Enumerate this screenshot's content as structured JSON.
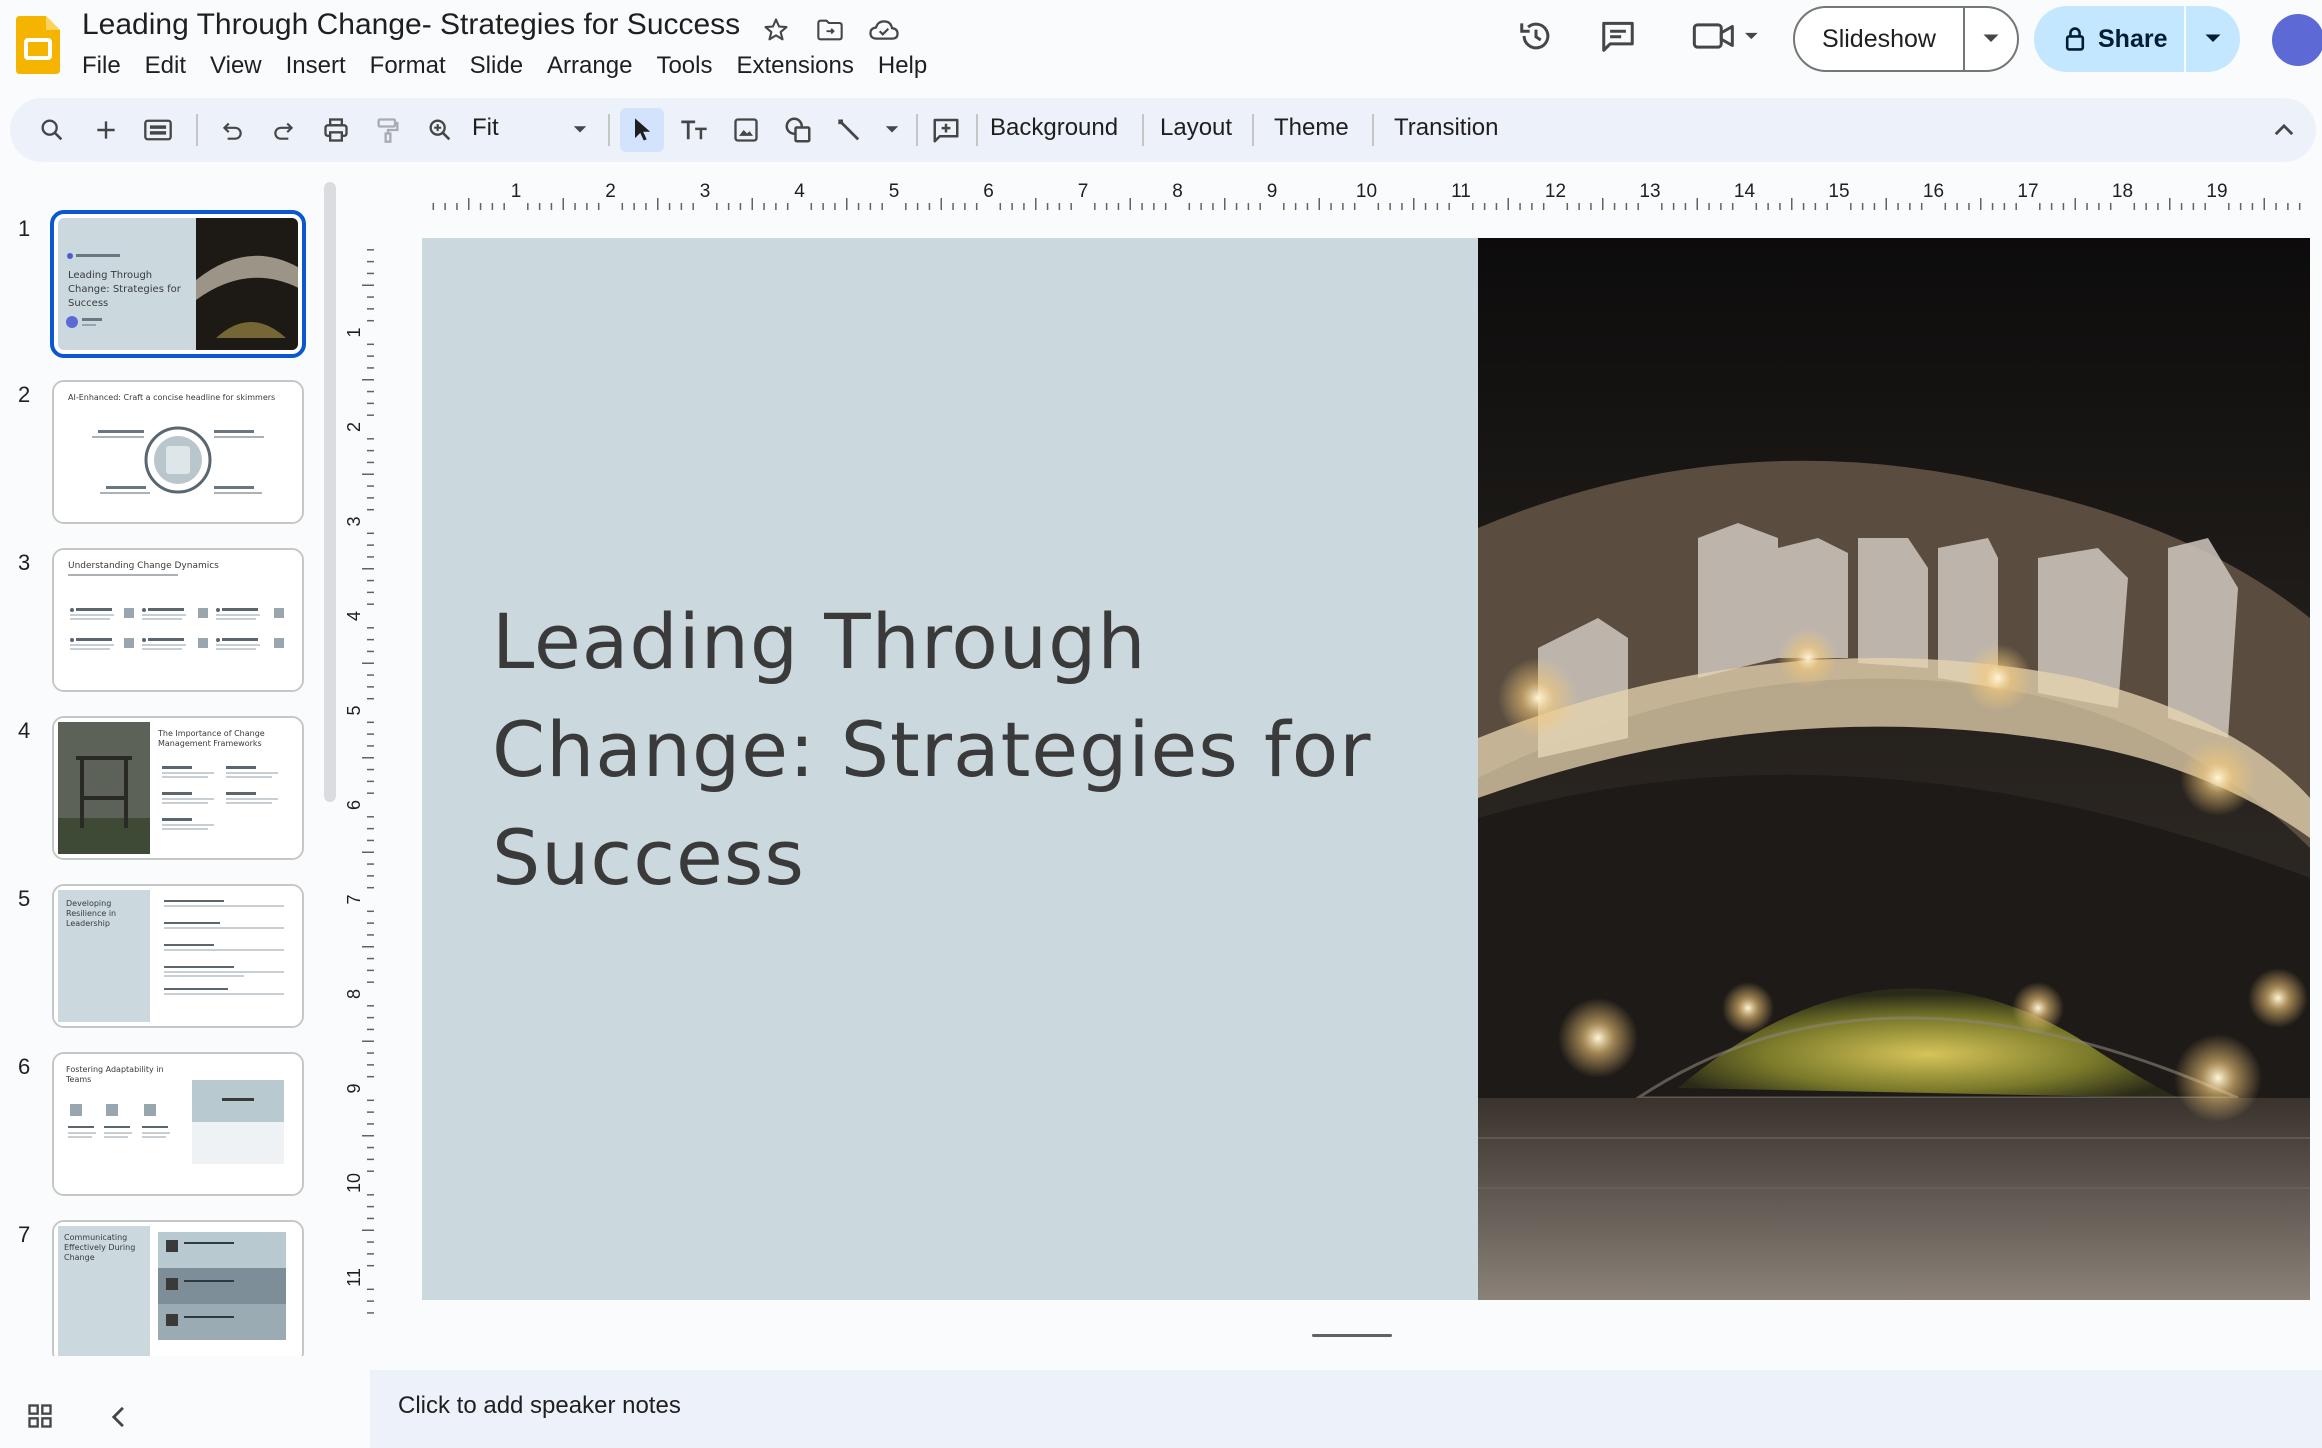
{
  "app": {
    "doc_title": "Leading Through Change- Strategies for Success",
    "menu": [
      "File",
      "Edit",
      "View",
      "Insert",
      "Format",
      "Slide",
      "Arrange",
      "Tools",
      "Extensions",
      "Help"
    ],
    "slideshow_label": "Slideshow",
    "share_label": "Share"
  },
  "toolbar": {
    "zoom_value": "Fit",
    "background_label": "Background",
    "layout_label": "Layout",
    "theme_label": "Theme",
    "transition_label": "Transition"
  },
  "rulers": {
    "horizontal_ticks": [
      "1",
      "2",
      "3",
      "4",
      "5",
      "6",
      "7",
      "8",
      "9",
      "10",
      "11",
      "12",
      "13",
      "14",
      "15",
      "16",
      "17",
      "18",
      "19"
    ],
    "vertical_ticks": [
      "1",
      "2",
      "3",
      "4",
      "5",
      "6",
      "7",
      "8",
      "9",
      "10",
      "11"
    ]
  },
  "filmstrip": {
    "slides": [
      {
        "number": "1",
        "title": "Leading Through Change: Strategies for Success",
        "selected": true
      },
      {
        "number": "2",
        "title": "AI-Enhanced: Craft a concise headline for skimmers"
      },
      {
        "number": "3",
        "title": "Understanding Change Dynamics"
      },
      {
        "number": "4",
        "title": "The Importance of Change Management Frameworks"
      },
      {
        "number": "5",
        "title": "Developing Resilience in Leadership"
      },
      {
        "number": "6",
        "title": "Fostering Adaptability in Teams"
      },
      {
        "number": "7",
        "title": "Communicating Effectively During Change"
      }
    ]
  },
  "slide": {
    "title_line1": "Leading Through",
    "title_line2": "Change: Strategies for",
    "title_line3": "Success"
  },
  "notes": {
    "placeholder": "Click to add speaker notes"
  },
  "colors": {
    "slide_bg": "#cbd9df",
    "accent_blue": "#0b57d0",
    "share_bg": "#c2e7ff",
    "toolbar_bg": "#edf2fa"
  }
}
